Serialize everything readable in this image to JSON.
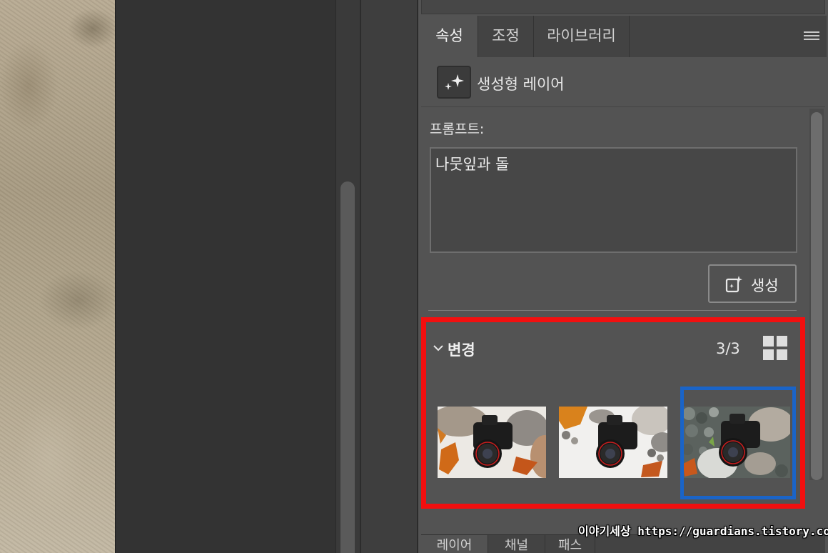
{
  "tabs": [
    {
      "label": "속성",
      "active": true
    },
    {
      "label": "조정",
      "active": false
    },
    {
      "label": "라이브러리",
      "active": false
    }
  ],
  "layer": {
    "icon": "sparkle-icon",
    "label": "생성형 레이어"
  },
  "prompt": {
    "label": "프롬프트:",
    "value": "나뭇잎과 돌"
  },
  "generate_button": {
    "label": "생성",
    "icon": "generate-sparkle-icon"
  },
  "variations": {
    "title": "변경",
    "count": "3/3",
    "selected_index": 3,
    "items": [
      {
        "name": "variation-1"
      },
      {
        "name": "variation-2"
      },
      {
        "name": "variation-3"
      }
    ]
  },
  "bottom_tabs": [
    {
      "label": "레이어"
    },
    {
      "label": "채널"
    },
    {
      "label": "패스"
    }
  ],
  "watermark": "이야기세상 https://guardians.tistory.com",
  "colors": {
    "highlight_red": "#f20f0f",
    "selection_blue": "#1a64c8"
  }
}
